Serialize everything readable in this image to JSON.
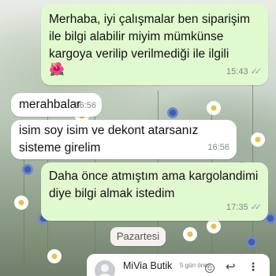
{
  "messages": [
    {
      "direction": "out",
      "text": "Merhaba, iyi çalışmalar ben siparişim ile bilgi alabilir miyim mümkünse kargoya verilip verilmediği ile ilgili",
      "emoji": "🌺",
      "time": "15:43",
      "ticks": "✓✓"
    },
    {
      "direction": "in",
      "text": "merahbalar",
      "time": "16:56"
    },
    {
      "direction": "in",
      "text": "isim soy isim ve dekont atarsanız sisteme girelim",
      "time": "16:56"
    },
    {
      "direction": "out",
      "text": "Daha önce atmıştım ama kargolandimi diye bilgi almak istedim",
      "time": "17:35",
      "ticks": "✓✓"
    }
  ],
  "date_separator": "Pazartesi",
  "email": {
    "sender": "MiVia Butik",
    "when": "5 gün önce",
    "icons": [
      "smiley-icon",
      "reply-icon",
      "more-icon"
    ]
  }
}
